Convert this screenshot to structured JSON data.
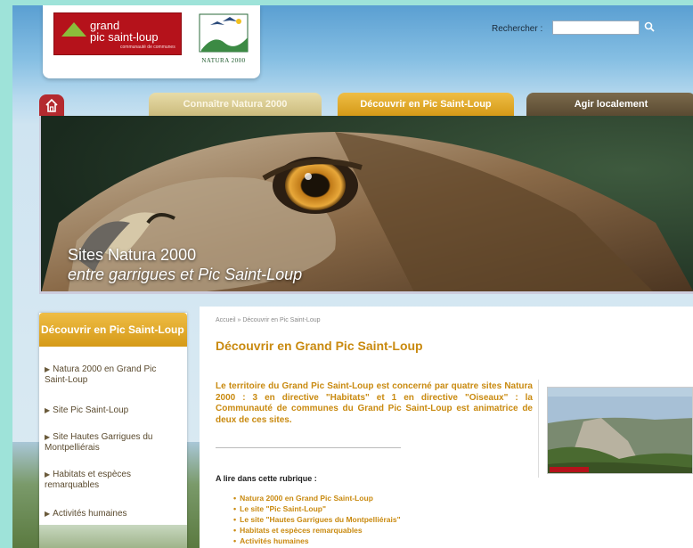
{
  "logo": {
    "line1": "grand",
    "line2": "pic saint-loup",
    "tagline": "communauté de communes",
    "natura": "NATURA 2000"
  },
  "search": {
    "label": "Rechercher :",
    "value": ""
  },
  "nav": {
    "tabs": [
      {
        "label": "Connaître Natura 2000"
      },
      {
        "label": "Découvrir en Pic Saint-Loup"
      },
      {
        "label": "Agir localement"
      }
    ]
  },
  "banner": {
    "title": "Sites Natura 2000",
    "subtitle": "entre garrigues et Pic Saint-Loup"
  },
  "sidebar": {
    "header": "Découvrir en Pic Saint-Loup",
    "items": [
      {
        "label": "Natura 2000 en Grand Pic Saint-Loup"
      },
      {
        "label": "Site Pic Saint-Loup"
      },
      {
        "label": "Site Hautes Garrigues du Montpelliérais"
      },
      {
        "label": "Habitats et espèces remarquables"
      },
      {
        "label": "Activités humaines"
      }
    ]
  },
  "main": {
    "breadcrumb": "Accueil » Découvrir en Pic Saint-Loup",
    "title": "Découvrir en Grand Pic Saint-Loup",
    "intro": "Le territoire du Grand Pic Saint-Loup est concerné par quatre sites Natura 2000 : 3 en directive \"Habitats\" et 1 en directive \"Oiseaux\" : la Communauté de communes du Grand Pic Saint-Loup est animatrice de deux de ces sites.",
    "rubrique_title": "A lire dans cette rubrique :",
    "rubrique_items": [
      "Natura 2000 en Grand Pic Saint-Loup",
      "Le site \"Pic Saint-Loup\"",
      "Le site \"Hautes Garrigues du Montpelliérais\"",
      "Habitats et espèces remarquables",
      "Activités humaines"
    ]
  },
  "colors": {
    "gold": "#d59a18",
    "red": "#b5121b",
    "brown": "#5a4a32"
  }
}
